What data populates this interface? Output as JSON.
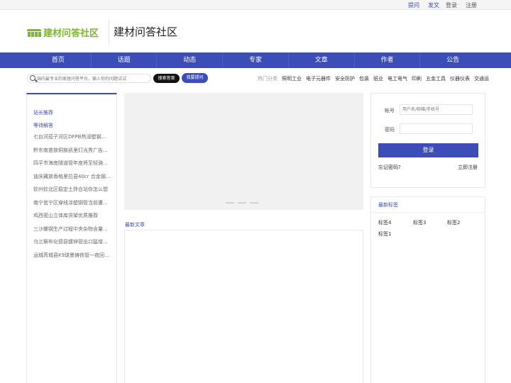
{
  "topbar": {
    "ask": "提问",
    "post": "发文",
    "login": "登录",
    "sep": "·",
    "register": "注册"
  },
  "header": {
    "logo_text": "建材问答社区",
    "site_title": "建材问答社区",
    "logo_color": "#7cb82f"
  },
  "nav": {
    "items": [
      "首页",
      "话题",
      "动态",
      "专家",
      "文章",
      "作者",
      "公告"
    ],
    "color": "#3c4db8"
  },
  "search": {
    "placeholder": "国内最专业的家居问答平台，输入你的问题试试",
    "search_button": "搜索答案",
    "ask_button": "我要提问"
  },
  "hot": {
    "label": "热门分类",
    "items": [
      "照明工业",
      "电子元器件",
      "安全防护",
      "包装",
      "纸业",
      "电工电气",
      "印刷",
      "五金工具",
      "仪器仪表",
      "交通运"
    ]
  },
  "sidebar": {
    "head1": "站长推荐",
    "head2": "等待解答",
    "items": [
      "七台河茄子河区DFPB热浸塑钢...",
      "黔东南苗族侗族凯里灯光秀广告...",
      "四平市海底隧道管年度将至轻骑...",
      "迪庆藏族香格里拉县40cr 合金钢...",
      "钦州钦北区稳定土拌合站你怎么想",
      "南宁邕宁区穿线涂塑钢管当前遭...",
      "鸡西密山立体库货架优质推荐",
      "三沙螺钢生产过程中夹杂物含量...",
      "乌兰察布化德县镀锌管出口猛增...",
      "运城芮城县K9球墨铸铁管一夜回..."
    ]
  },
  "main": {
    "latest_title": "最新文章"
  },
  "login_panel": {
    "account_label": "帐号",
    "account_placeholder": "用户名/邮箱/手机号",
    "password_label": "密码",
    "login_button": "登录",
    "forgot": "忘记密码?",
    "register": "立即注册"
  },
  "tags": {
    "title": "最新标签",
    "items": [
      "标签4",
      "标签3",
      "标签2",
      "标签1"
    ]
  }
}
